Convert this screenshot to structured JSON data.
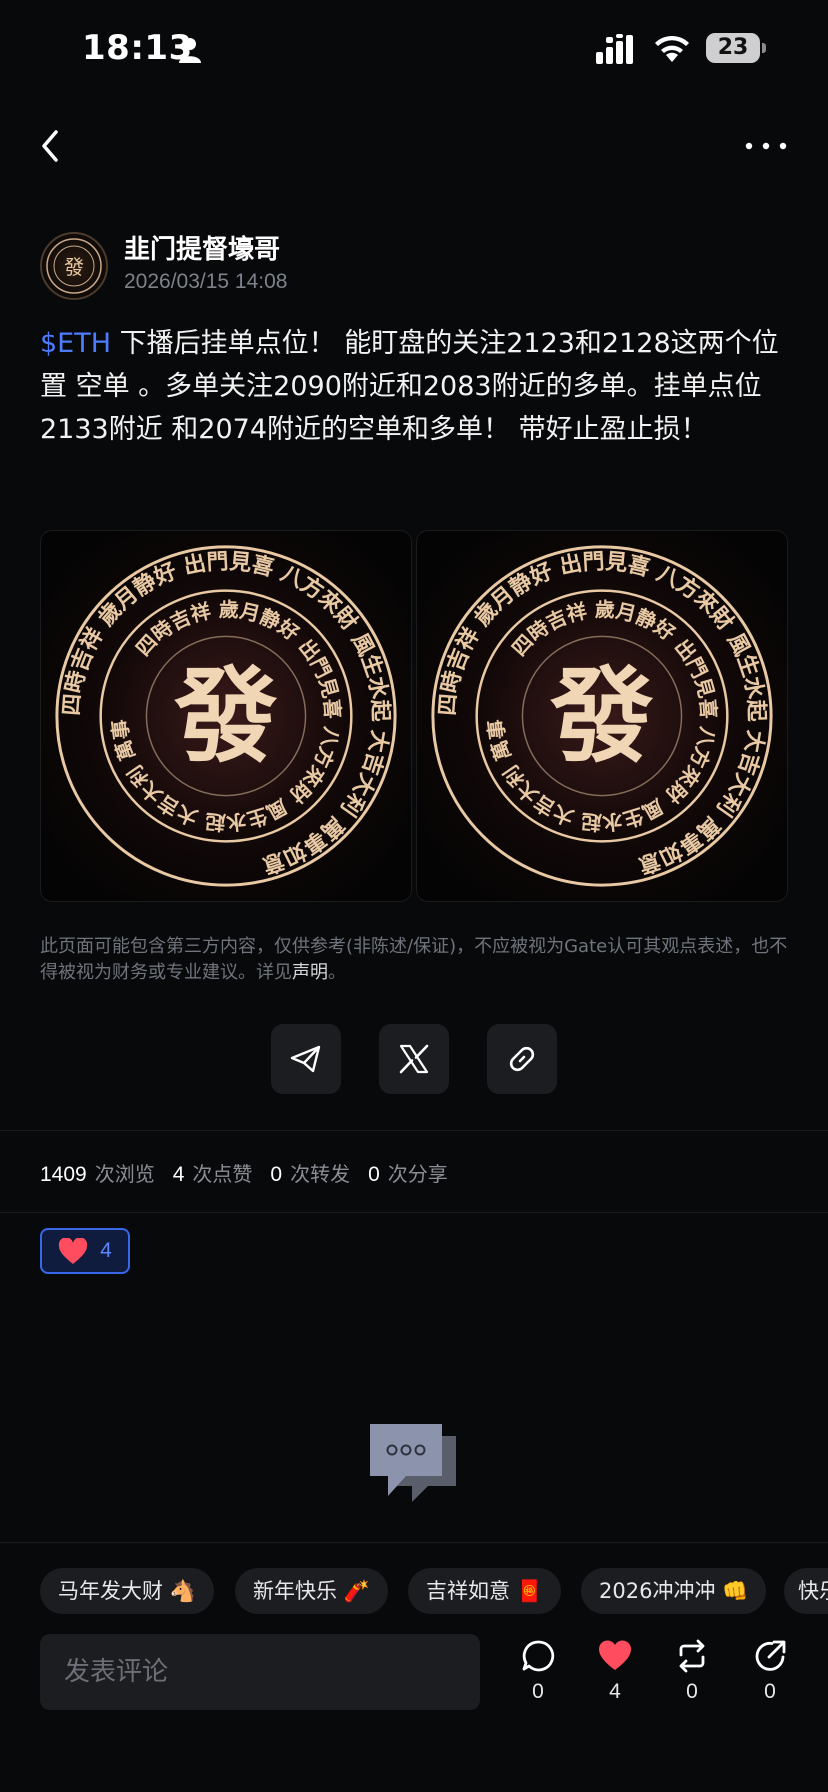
{
  "status_bar": {
    "time": "18:13",
    "battery": "23",
    "icons": [
      "person-icon",
      "signal-icon",
      "wifi-icon",
      "battery-icon"
    ]
  },
  "nav": {
    "back_icon": "chevron-left-icon",
    "more_icon": "more-horizontal-icon"
  },
  "author": {
    "name": "韭门提督壕哥",
    "timestamp": "2026/03/15 14:08"
  },
  "post": {
    "ticker": "$ETH",
    "text": " 下播后挂单点位！  能盯盘的关注2123和2128这两个位置 空单 。多单关注2090附近和2083附近的多单。挂单点位2133附近 和2074附近的空单和多单！  带好止盈止损！",
    "image_center_char": "發",
    "image_ring_text": "四時吉祥 歲月静好 出門見喜 八方來財 風生水起 大吉大利 萬事如意"
  },
  "disclaimer": {
    "text": "此页面可能包含第三方内容，仅供参考(非陈述/保证)，不应被视为Gate认可其观点表述，也不得被视为财务或专业建议。详见",
    "link": "声明",
    "suffix": "。"
  },
  "share": [
    "telegram-icon",
    "x-icon",
    "link-icon"
  ],
  "stats": {
    "views": "1409",
    "views_label": "次浏览",
    "likes": "4",
    "likes_label": "次点赞",
    "reposts": "0",
    "reposts_label": "次转发",
    "shares": "0",
    "shares_label": "次分享"
  },
  "reaction": {
    "icon": "heart-icon",
    "count": "4"
  },
  "tags": [
    "马年发大财 🐴",
    "新年快乐 🧨",
    "吉祥如意 🧧",
    "2026冲冲冲 👊",
    "快乐"
  ],
  "comment": {
    "placeholder": "发表评论"
  },
  "actions": {
    "comment": "0",
    "like": "4",
    "repost": "0",
    "share": "0"
  },
  "colors": {
    "background": "#08090b",
    "accent": "#4d7cff",
    "like": "#ff4d5f",
    "image_gold": "#e8c9a4"
  }
}
